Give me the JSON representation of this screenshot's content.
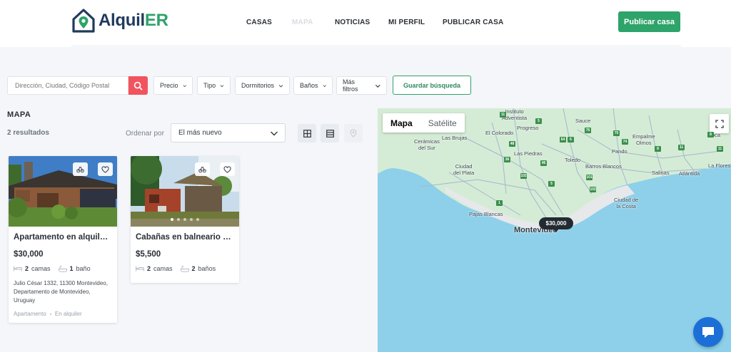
{
  "header": {
    "logo_a": "Alquil",
    "logo_er": "ER",
    "nav": [
      "CASAS",
      "MAPA",
      "NOTICIAS",
      "MI PERFIL",
      "PUBLICAR CASA"
    ],
    "cta": "Publicar casa"
  },
  "filters": {
    "search_placeholder": "Dirección, Ciudad, Código Postal",
    "precio": "Precio",
    "tipo": "Tipo",
    "dormitorios": "Dormitorios",
    "banos": "Baños",
    "mas": "Más filtros",
    "save": "Guardar búsqueda"
  },
  "list": {
    "title": "MAPA",
    "results": "2 resultados",
    "sort_label": "Ordenar por",
    "sort_value": "El más nuevo"
  },
  "cards": [
    {
      "title": "Apartamento en alquiler –...",
      "price": "$30,000",
      "beds": "2",
      "beds_label": "camas",
      "baths": "1",
      "baths_label": "baño",
      "address": "Julio César 1332, 11300 Montevideo, Departamento de Montevideo, Uruguay",
      "type": "Apartamento",
      "status": "En alquiler"
    },
    {
      "title": "Cabañas en balneario Solis",
      "price": "$5,500",
      "beds": "2",
      "beds_label": "camas",
      "baths": "2",
      "baths_label": "baños"
    }
  ],
  "map": {
    "tab_map": "Mapa",
    "tab_sat": "Satélite",
    "pin_price": "$30,000",
    "places": {
      "adventista": "Instituto\nAdventista",
      "progreso": "Progreso",
      "sauce": "Sauce",
      "las_brujas": "Las Brujas",
      "el_colorado": "El Colorado",
      "ceramicas": "Cerámicas\ndel Sur",
      "las_piedras": "Las Piedras",
      "toledo": "Toledo",
      "pando": "Pando",
      "empalme": "Empalme\nOlmos",
      "soca": "Soca",
      "ciudad_plata": "Ciudad\ndel Plata",
      "barros": "Barros Blancos",
      "salinas": "Salinas",
      "atlantida": "Atlántida",
      "la_floresta": "La Florest",
      "ciudad_costa": "Ciudad de\nla Costa",
      "pajas": "Pajas Blancas",
      "montevideo": "Montevideo"
    },
    "routes": [
      "11",
      "5",
      "76",
      "64",
      "48",
      "36",
      "46",
      "102",
      "5",
      "6",
      "75",
      "74",
      "8",
      "11",
      "101",
      "102",
      "1",
      "8",
      "11"
    ]
  },
  "colors": {
    "brand_green": "#2ea36a",
    "brand_navy": "#213a5c",
    "search_red": "#f1545f",
    "chat_blue": "#1c6fd6"
  }
}
